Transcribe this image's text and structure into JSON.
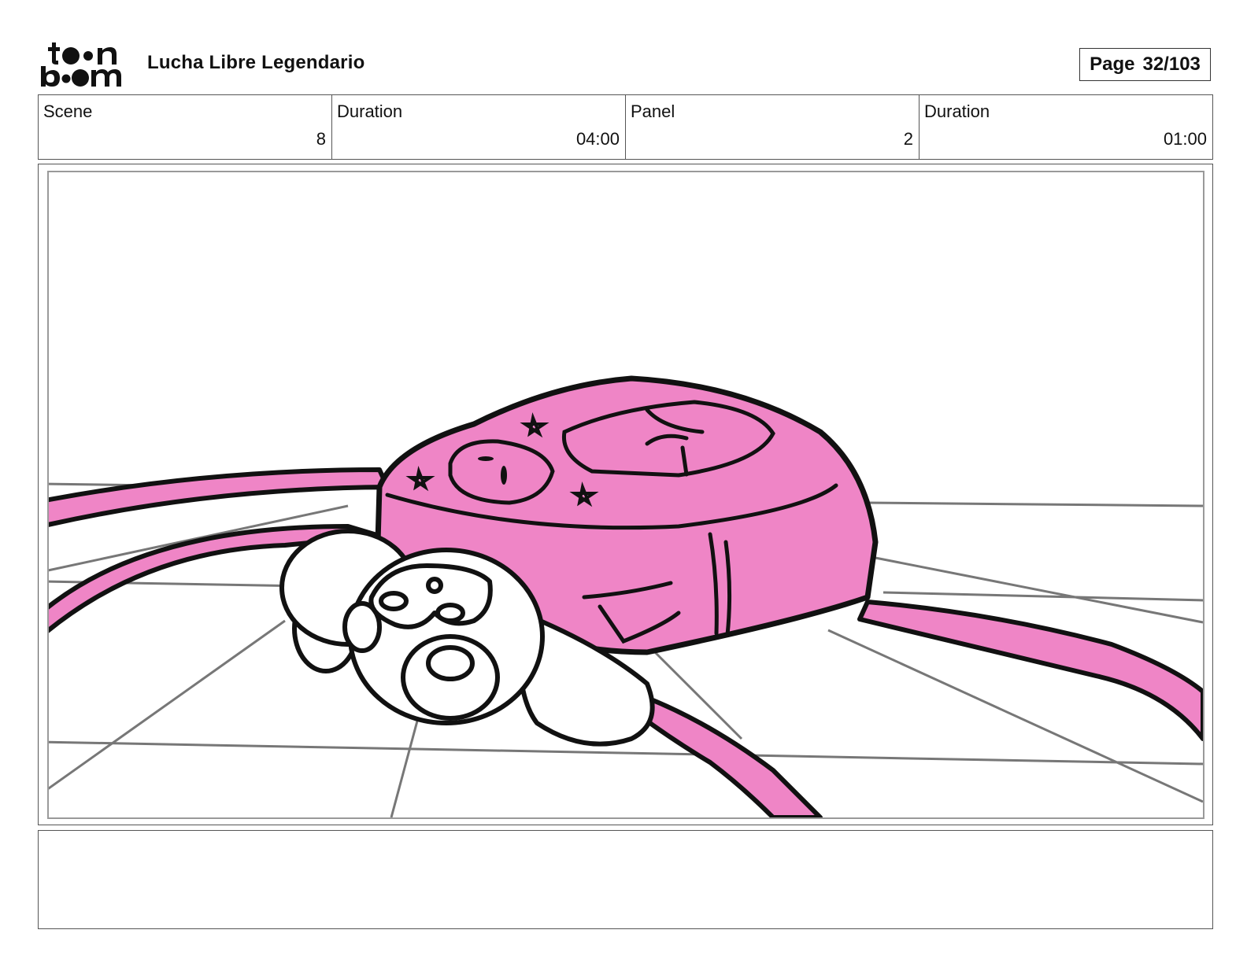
{
  "header": {
    "logo": {
      "line1": "toon",
      "line2": "boom"
    },
    "project_title": "Lucha Libre Legendario",
    "page_label": "Page",
    "page_value": "32/103"
  },
  "info_bar": {
    "scene": {
      "label": "Scene",
      "value": "8"
    },
    "scene_duration": {
      "label": "Duration",
      "value": "04:00"
    },
    "panel": {
      "label": "Panel",
      "value": "2"
    },
    "panel_duration": {
      "label": "Duration",
      "value": "01:00"
    }
  },
  "drawing": {
    "description_icon": "backpack-sketch-icon",
    "ink_color": "#111111",
    "fill_color": "#ef85c6",
    "floor_line_color": "#777777"
  },
  "notes": {
    "text": ""
  }
}
